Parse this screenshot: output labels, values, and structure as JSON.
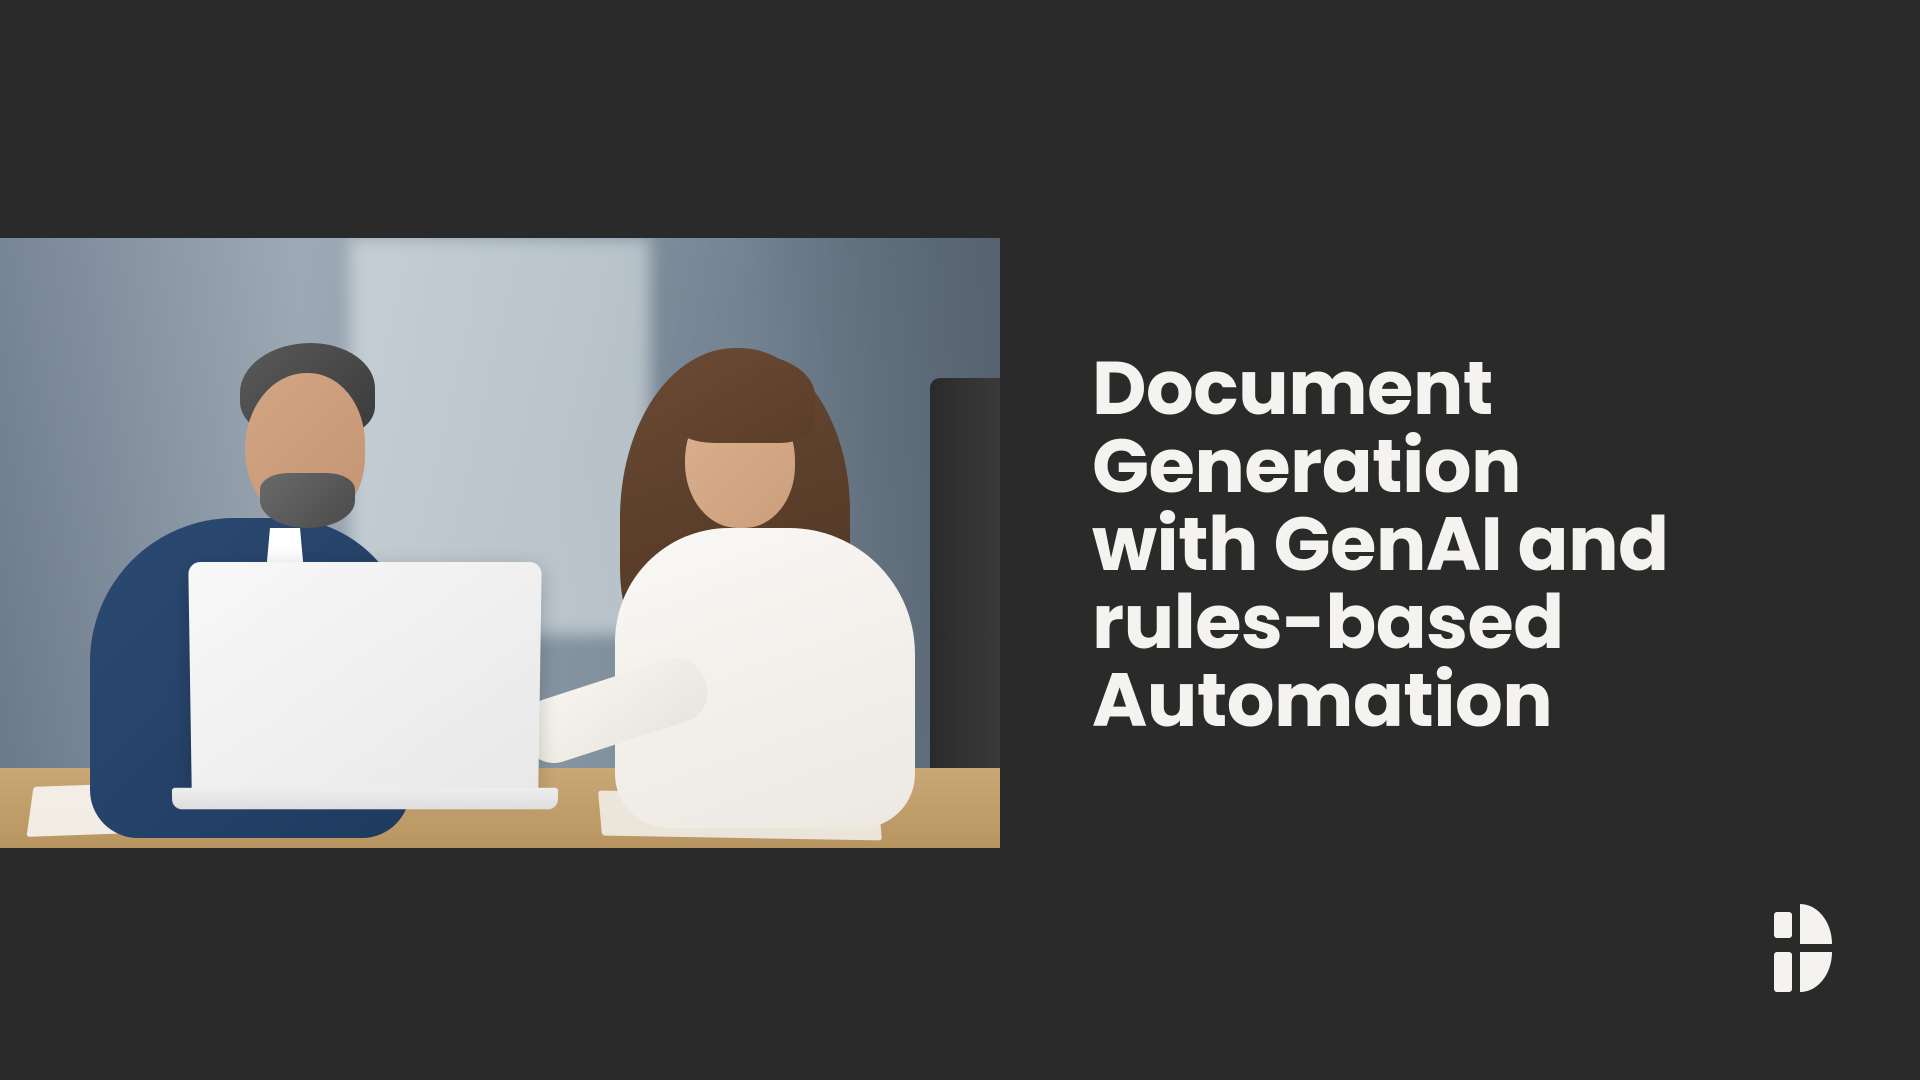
{
  "slide": {
    "headline": "Document Generation with GenAI and rules-based Automation"
  },
  "image": {
    "description": "Two business professionals, a man in a navy suit and a woman in a white blouse, collaborating at a laptop in a modern office"
  },
  "logo": {
    "name": "brand-mark"
  },
  "colors": {
    "background": "#2a2a2a",
    "text": "#f5f3f0",
    "logo": "#f5f3f0"
  }
}
